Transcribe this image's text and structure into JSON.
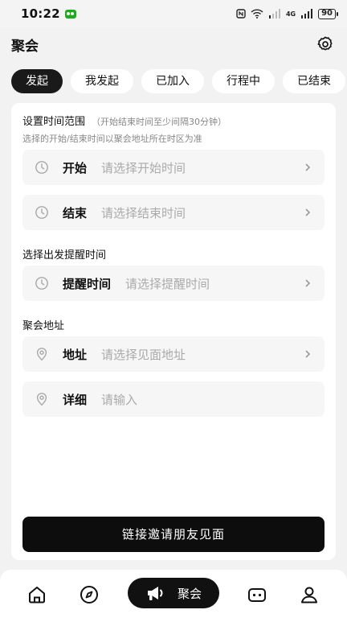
{
  "status_bar": {
    "time": "10:22",
    "network": "4G",
    "battery": "90"
  },
  "header": {
    "title": "聚会"
  },
  "tabs": [
    {
      "label": "发起",
      "active": true
    },
    {
      "label": "我发起",
      "active": false
    },
    {
      "label": "已加入",
      "active": false
    },
    {
      "label": "行程中",
      "active": false
    },
    {
      "label": "已结束",
      "active": false
    }
  ],
  "time_section": {
    "title": "设置时间范围",
    "note": "（开始结束时间至少间隔30分钟）",
    "hint": "选择的开始/结束时间以聚会地址所在时区为准",
    "start": {
      "label": "开始",
      "placeholder": "请选择开始时间",
      "icon": "clock-icon"
    },
    "end": {
      "label": "结束",
      "placeholder": "请选择结束时间",
      "icon": "clock-icon"
    }
  },
  "reminder_section": {
    "title": "选择出发提醒时间",
    "field": {
      "label": "提醒时间",
      "placeholder": "请选择提醒时间",
      "icon": "clock-icon"
    }
  },
  "address_section": {
    "title": "聚会地址",
    "address": {
      "label": "地址",
      "placeholder": "请选择见面地址",
      "icon": "location-pin-icon"
    },
    "detail": {
      "label": "详细",
      "placeholder": "请输入",
      "icon": "location-pin-icon"
    }
  },
  "primary_button": {
    "label": "链接邀请朋友见面"
  },
  "bottom_nav": {
    "items": [
      {
        "icon": "home-icon"
      },
      {
        "icon": "compass-icon"
      },
      {
        "icon": "megaphone-icon",
        "label": "聚会",
        "active": true
      },
      {
        "icon": "chat-bot-icon"
      },
      {
        "icon": "profile-icon"
      }
    ]
  },
  "colors": {
    "background": "#f2f2f2",
    "accent": "#111111",
    "field_bg": "#f6f6f6",
    "placeholder": "#aaaaaa"
  }
}
